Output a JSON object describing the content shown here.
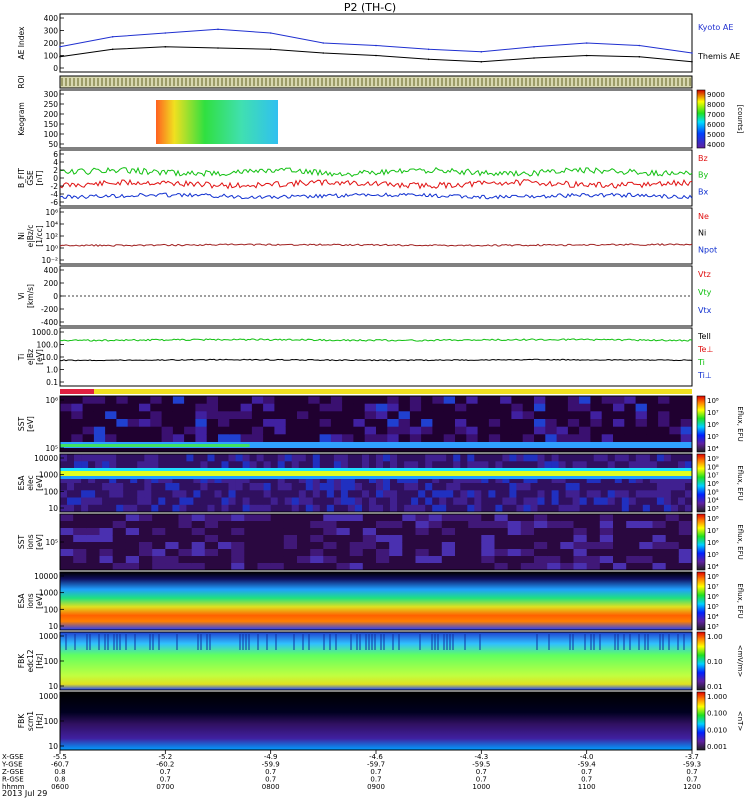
{
  "title": "P2 (TH-C)",
  "date_label": "2013 Jul 29",
  "colors": {
    "ae_kyoto": "#2030d0",
    "ae_themis": "#000000",
    "bz": "#e01010",
    "by": "#10c010",
    "bx": "#1030d0",
    "line_axis": "#000000"
  },
  "panels": {
    "ae": {
      "ylabel": "AE Index",
      "ticks": [
        "400",
        "300",
        "200",
        "100",
        "0"
      ],
      "legend": [
        "Kyoto AE",
        "Themis AE"
      ]
    },
    "roi": {
      "ylabel": "ROI"
    },
    "keogram": {
      "ylabel": "Keogram",
      "ticks": [
        "300",
        "250",
        "200",
        "150",
        "100",
        "50"
      ],
      "cbar_ticks": [
        "9000",
        "8000",
        "7000",
        "6000",
        "5000",
        "4000"
      ],
      "cbar_label": "[counts]"
    },
    "bfield": {
      "ylabel": "B_FIT",
      "ylabel2": "GSE",
      "ylabel3": "[nT]",
      "ticks": [
        "6",
        "4",
        "2",
        "0",
        "-2",
        "-4",
        "-6"
      ],
      "legend": [
        "Bz",
        "By",
        "Bx"
      ]
    },
    "density": {
      "ylabel": "Ni",
      "ylabel2": "e|Bz/c",
      "ylabel3": "[1/cc]",
      "ticks": [
        "10⁶",
        "10⁴",
        "10²",
        "10⁰",
        "10⁻²"
      ],
      "legend": [
        "Ne",
        "Ni",
        "Npot"
      ]
    },
    "velocity": {
      "ylabel": "Vi",
      "ylabel2": "[km/s]",
      "ticks": [
        "400",
        "200",
        "0",
        "-200",
        "-400"
      ],
      "legend": [
        "Vtz",
        "Vty",
        "Vtx"
      ]
    },
    "temp": {
      "ylabel": "Ti",
      "ylabel2": "e|Bz",
      "ylabel3": "[eV]",
      "ticks": [
        "1000.0",
        "100.0",
        "10.0",
        "1.0",
        "0.1"
      ],
      "legend": [
        "Tell",
        "Te⊥",
        "Ti",
        "Ti⊥"
      ]
    },
    "sst_e": {
      "ylabel": "SST",
      "ylabel2": "[eV]",
      "ticks": [
        "10⁶",
        "10⁵"
      ],
      "cbar_label": "Eflux, EFU",
      "cbar_ticks": [
        "10⁸",
        "10⁷",
        "10⁶",
        "10⁵",
        "10⁴"
      ]
    },
    "esa_e": {
      "ylabel": "ESA",
      "ylabel2": "elec",
      "ylabel3": "[eV]",
      "ticks": [
        "10000",
        "1000",
        "100",
        "10"
      ],
      "cbar_label": "Eflux, EFU",
      "cbar_ticks": [
        "10⁹",
        "10⁸",
        "10⁷",
        "10⁶",
        "10⁵",
        "10⁴",
        "10³"
      ]
    },
    "sst_i": {
      "ylabel": "SST",
      "ylabel2": "ions",
      "ylabel3": "[eV]",
      "ticks": [
        "10⁵"
      ],
      "cbar_label": "Eflux, EFU",
      "cbar_ticks": [
        "10⁸",
        "10⁷",
        "10⁶",
        "10⁵",
        "10⁴"
      ]
    },
    "esa_i": {
      "ylabel": "ESA",
      "ylabel2": "ions",
      "ylabel3": "[eV]",
      "ticks": [
        "10000",
        "1000",
        "100",
        "10"
      ],
      "cbar_label": "Eflux, EFU",
      "cbar_ticks": [
        "10⁸",
        "10⁷",
        "10⁶",
        "10⁵",
        "10⁴",
        "10³"
      ]
    },
    "fbk_e": {
      "ylabel": "FBK",
      "ylabel2": "edc12",
      "ylabel3": "[Hz]",
      "ticks": [
        "1000",
        "100",
        "10"
      ],
      "cbar_label": "<mV/m>",
      "cbar_ticks": [
        "1.00",
        "0.10",
        "0.01"
      ]
    },
    "fbk_b": {
      "ylabel": "FBK",
      "ylabel2": "scm1",
      "ylabel3": "[Hz]",
      "ticks": [
        "1000",
        "100",
        "10"
      ],
      "cbar_label": "<nT>",
      "cbar_ticks": [
        "1.000",
        "0.100",
        "0.010",
        "0.001"
      ]
    }
  },
  "xaxis": {
    "row_labels": [
      "X-GSE",
      "Y-GSE",
      "Z-GSE",
      "R-GSE",
      "hhmm"
    ],
    "columns": [
      [
        "-5.5",
        "-60.7",
        "0.8",
        "0600"
      ],
      [
        "-5.2",
        "-60.2",
        "0.7",
        "0700"
      ],
      [
        "-4.9",
        "-59.9",
        "0.7",
        "0800"
      ],
      [
        "-4.6",
        "-59.7",
        "0.7",
        "0900"
      ],
      [
        "-4.3",
        "-59.5",
        "0.7",
        "1000"
      ],
      [
        "-4.0",
        "-59.4",
        "0.7",
        "1100"
      ],
      [
        "-3.7",
        "-59.3",
        "0.7",
        "1200"
      ]
    ]
  },
  "chart_data": {
    "type": "line",
    "title": "P2 (TH-C)",
    "x": [
      "0600",
      "0630",
      "0700",
      "0730",
      "0800",
      "0830",
      "0900",
      "0930",
      "1000",
      "1030",
      "1100",
      "1130",
      "1200"
    ],
    "series": [
      {
        "name": "Kyoto AE",
        "values": [
          170,
          250,
          280,
          310,
          280,
          200,
          180,
          150,
          130,
          170,
          200,
          180,
          120
        ]
      },
      {
        "name": "Themis AE",
        "values": [
          90,
          150,
          170,
          160,
          150,
          120,
          100,
          70,
          50,
          80,
          100,
          90,
          50
        ]
      }
    ],
    "ylabel": "AE Index",
    "ylim": [
      0,
      400
    ]
  }
}
